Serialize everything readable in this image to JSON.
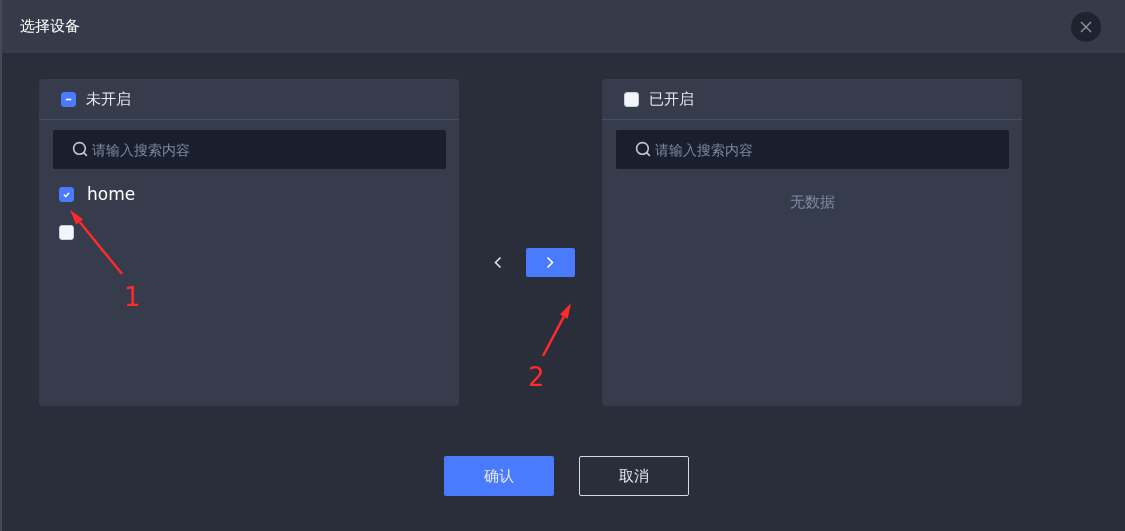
{
  "dialog": {
    "title": "选择设备"
  },
  "panels": [
    {
      "title": "未开启",
      "header_indeterminate": true,
      "search": {
        "placeholder": "请输入搜索内容"
      },
      "items": [
        {
          "label": "home",
          "checked": true
        },
        {
          "checked": false
        }
      ]
    },
    {
      "title": "已开启",
      "header_indeterminate": false,
      "search": {
        "placeholder": "请输入搜索内容"
      },
      "empty_text": "无数据"
    }
  ],
  "transfer_buttons": [
    {
      "kind": "left",
      "disabled": true
    },
    {
      "kind": "right",
      "disabled": false
    }
  ],
  "annotations": [
    {
      "label": "1"
    },
    {
      "label": "2"
    }
  ],
  "buttons": [
    {
      "label": "确认",
      "kind": "primary"
    },
    {
      "label": "取消",
      "kind": "secondary"
    }
  ]
}
